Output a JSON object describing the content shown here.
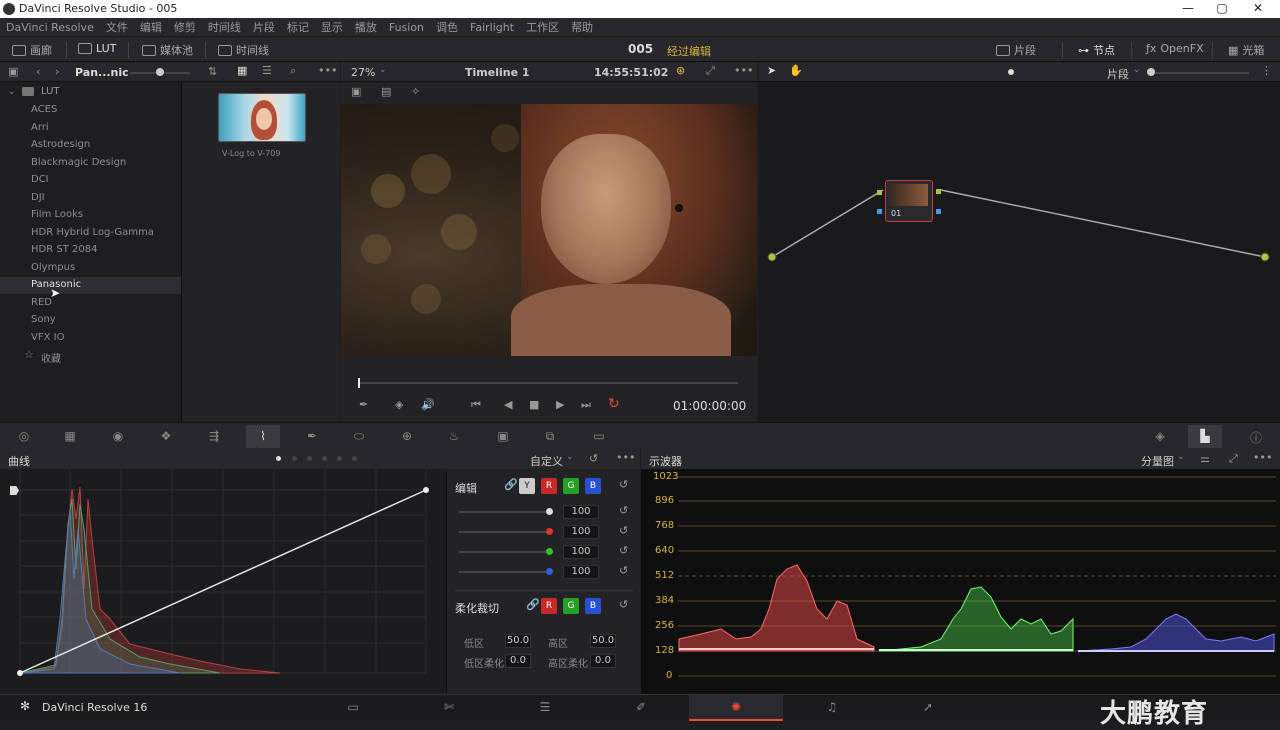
{
  "window": {
    "title": "DaVinci Resolve Studio - 005"
  },
  "menu": [
    "DaVinci Resolve",
    "文件",
    "编辑",
    "修剪",
    "时间线",
    "片段",
    "标记",
    "显示",
    "播放",
    "Fusion",
    "调色",
    "Fairlight",
    "工作区",
    "帮助"
  ],
  "toolbar": {
    "gallery": "画廊",
    "lut": "LUT",
    "media_pool": "媒体池",
    "timeline": "时间线",
    "project": "005",
    "status": "经过编辑",
    "clips": "片段",
    "nodes": "节点",
    "openfx": "OpenFX",
    "lightbox": "光箱"
  },
  "lut_browser": {
    "breadcrumb": "Pan...nic",
    "root": "LUT",
    "items": [
      "ACES",
      "Arri",
      "Astrodesign",
      "Blackmagic Design",
      "DCI",
      "DJI",
      "Film Looks",
      "HDR Hybrid Log-Gamma",
      "HDR ST 2084",
      "Olympus",
      "Panasonic",
      "RED",
      "Sony",
      "VFX IO"
    ],
    "selected": "Panasonic",
    "favorites": "收藏",
    "thumb_label": "V-Log to V-709"
  },
  "viewer": {
    "zoom": "27%",
    "timeline_name": "Timeline 1",
    "timecode": "14:55:51:02",
    "playhead_tc": "01:00:00:00"
  },
  "nodes": {
    "clip_mode": "片段",
    "node_label": "01"
  },
  "curves": {
    "title": "曲线",
    "mode": "自定义",
    "edit_label": "编辑",
    "channels": [
      "Y",
      "R",
      "G",
      "B"
    ],
    "intensity": [
      "100",
      "100",
      "100",
      "100"
    ],
    "soft_clip_label": "柔化裁切",
    "low_label": "低区",
    "low_val": "50.0",
    "high_label": "高区",
    "high_val": "50.0",
    "low_soft_label": "低区柔化",
    "low_soft_val": "0.0",
    "high_soft_label": "高区柔化",
    "high_soft_val": "0.0"
  },
  "scope": {
    "title": "示波器",
    "mode": "分量图",
    "ticks": [
      "1023",
      "896",
      "768",
      "640",
      "512",
      "384",
      "256",
      "128",
      "0"
    ]
  },
  "footer": {
    "app": "DaVinci Resolve 16",
    "watermark": "大鹏教育"
  },
  "colors": {
    "accent": "#e64b3c",
    "status": "#d9b240",
    "node_border": "#c83c3c"
  }
}
